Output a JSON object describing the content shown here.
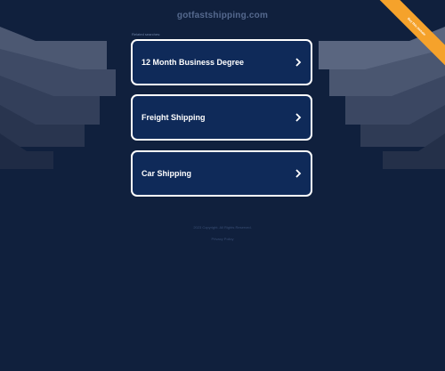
{
  "header": {
    "domain": "gotfastshipping.com"
  },
  "related_label": "Related searches:",
  "links": [
    {
      "label": "12 Month Business Degree"
    },
    {
      "label": "Freight Shipping"
    },
    {
      "label": "Car Shipping"
    }
  ],
  "footer": {
    "line1": "2023 Copyright. All Rights Reserved.",
    "line2": "Privacy Policy"
  },
  "ribbon": {
    "text": "Buy this domain"
  },
  "icons": {
    "link_arrow": "chevron-right-icon"
  },
  "colors": {
    "background": "#10203d",
    "card": "#0f2a59",
    "ribbon": "#f5a22b"
  }
}
